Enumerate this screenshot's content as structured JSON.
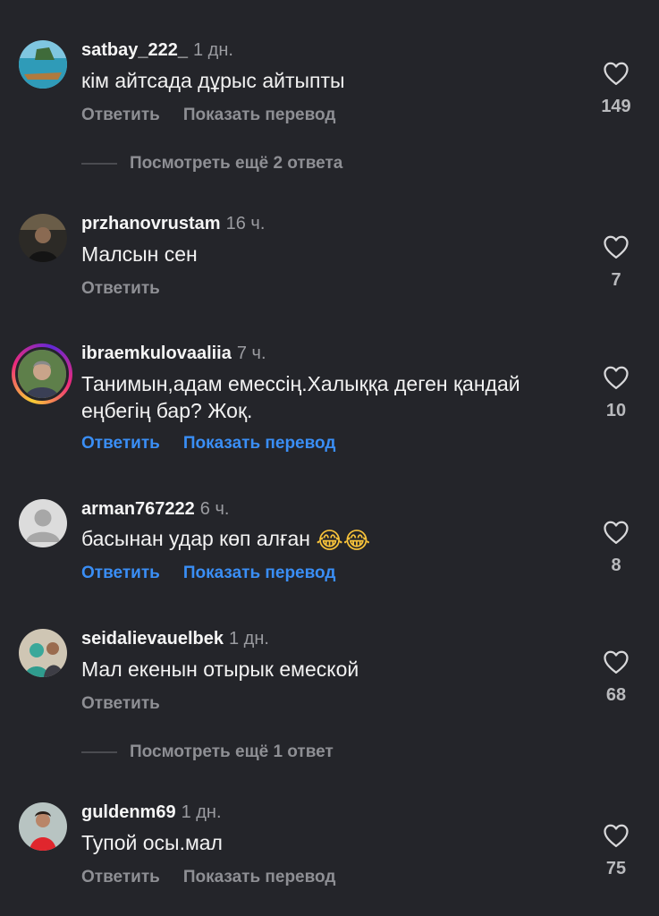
{
  "comments": [
    {
      "username": "satbay_222_",
      "time": "1 дн.",
      "text": "кім айтсада дұрыс айтыпты",
      "reply_label": "Ответить",
      "translate_label": "Показать перевод",
      "likes": "149",
      "more_replies": "Посмотреть ещё 2 ответа"
    },
    {
      "username": "przhanovrustam",
      "time": "16 ч.",
      "text": "Малсын сен",
      "reply_label": "Ответить",
      "likes": "7"
    },
    {
      "username": "ibraemkulovaaliia",
      "time": "7 ч.",
      "text": "Танимын,адам емессің.Халыққа деген қандай еңбегің бар? Жоқ.",
      "reply_label": "Ответить",
      "translate_label": "Показать перевод",
      "likes": "10"
    },
    {
      "username": "arman767222",
      "time": "6 ч.",
      "text": "басынан удар көп алған",
      "emoji": "😂😂",
      "reply_label": "Ответить",
      "translate_label": "Показать перевод",
      "likes": "8"
    },
    {
      "username": "seidalievauelbek",
      "time": "1 дн.",
      "text": "Мал екенын отырык емеской",
      "reply_label": "Ответить",
      "likes": "68",
      "more_replies": "Посмотреть ещё 1 ответ"
    },
    {
      "username": "guldenm69",
      "time": "1 дн.",
      "text": "Тупой осы.мал",
      "reply_label": "Ответить",
      "translate_label": "Показать перевод",
      "likes": "75"
    }
  ],
  "colors": {
    "background": "#24252a",
    "link_blue": "#3a8ef5",
    "muted": "#8e8f94"
  },
  "icons": {
    "like": "heart-outline-icon",
    "avatar_placeholder": "default-user-icon"
  }
}
